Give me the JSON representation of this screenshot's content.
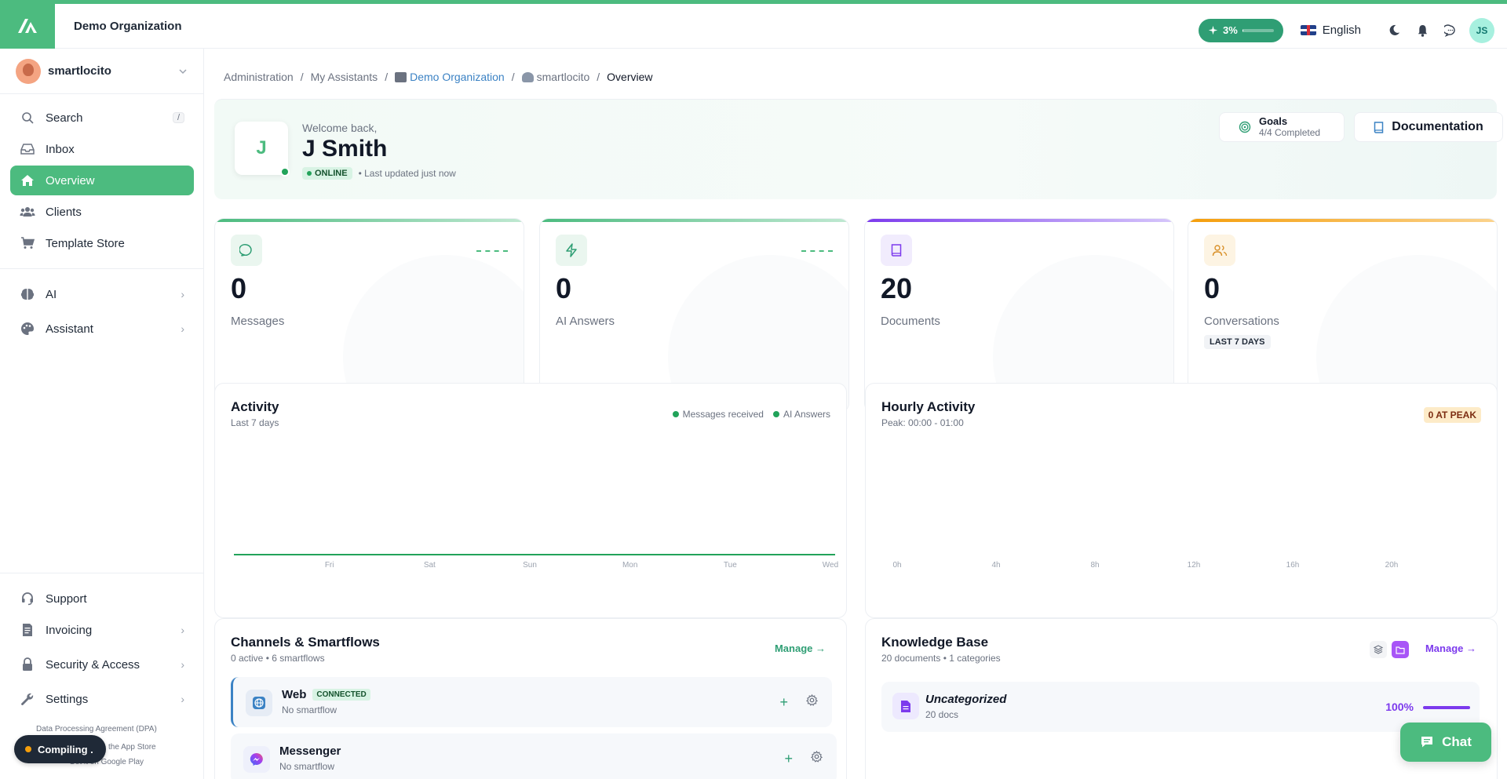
{
  "topbar": {
    "org_name": "Demo Organization",
    "credits_pct_label": "3%",
    "credits_pct": 3,
    "language": "English",
    "user_initials": "JS"
  },
  "sidebar": {
    "user_name": "smartlocito",
    "search_label": "Search",
    "search_shortcut": "/",
    "items": [
      {
        "label": "Inbox",
        "icon": "inbox-icon"
      },
      {
        "label": "Overview",
        "icon": "home-icon",
        "active": true
      },
      {
        "label": "Clients",
        "icon": "users-icon"
      },
      {
        "label": "Template Store",
        "icon": "cart-icon"
      }
    ],
    "groups": [
      {
        "label": "AI",
        "icon": "brain-icon"
      },
      {
        "label": "Assistant",
        "icon": "palette-icon"
      }
    ],
    "bottom_items": [
      {
        "label": "Support",
        "icon": "headset-icon"
      },
      {
        "label": "Invoicing",
        "icon": "invoice-icon"
      },
      {
        "label": "Security & Access",
        "icon": "lock-icon"
      },
      {
        "label": "Settings",
        "icon": "wrench-icon"
      }
    ],
    "footer_links": {
      "dpa": "Data Processing Agreement (DPA)",
      "app_store": "the App Store",
      "google_play": "Get it on Google Play"
    },
    "compiling_label": "Compiling ."
  },
  "breadcrumb": {
    "items": [
      "Administration",
      "My Assistants",
      "Demo Organization",
      "smartlocito",
      "Overview"
    ]
  },
  "welcome": {
    "initial": "J",
    "greeting": "Welcome back,",
    "name": "J Smith",
    "status": "ONLINE",
    "updated": "• Last updated just now",
    "goals_title": "Goals",
    "goals_sub": "4/4 Completed",
    "documentation": "Documentation"
  },
  "stats": [
    {
      "value": "0",
      "label": "Messages",
      "color": "#4cbb7f",
      "icon": "chat-bubble-icon"
    },
    {
      "value": "0",
      "label": "AI Answers",
      "color": "#4cbb7f",
      "icon": "lightning-icon"
    },
    {
      "value": "20",
      "label": "Documents",
      "color": "#7c3aed",
      "icon": "book-icon"
    },
    {
      "value": "0",
      "label": "Conversations",
      "color": "#f59e0b",
      "icon": "users-icon",
      "badge": "LAST 7 DAYS"
    }
  ],
  "activity": {
    "title": "Activity",
    "subtitle": "Last 7 days",
    "legend": [
      "Messages received",
      "AI Answers"
    ]
  },
  "hourly": {
    "title": "Hourly Activity",
    "subtitle": "Peak: 00:00 - 01:00",
    "badge": "0 AT PEAK"
  },
  "chart_data": [
    {
      "type": "line",
      "title": "Activity",
      "x": [
        "Fri",
        "Sat",
        "Sun",
        "Mon",
        "Tue",
        "Wed"
      ],
      "series": [
        {
          "name": "Messages received",
          "values": [
            0,
            0,
            0,
            0,
            0,
            0
          ]
        },
        {
          "name": "AI Answers",
          "values": [
            0,
            0,
            0,
            0,
            0,
            0
          ]
        }
      ],
      "legend": "top-right",
      "grid": false
    },
    {
      "type": "bar",
      "title": "Hourly Activity",
      "categories": [
        "0h",
        "4h",
        "8h",
        "12h",
        "16h",
        "20h"
      ],
      "values": [
        0,
        0,
        0,
        0,
        0,
        0
      ],
      "grid": false
    }
  ],
  "channels": {
    "title": "Channels & Smartflows",
    "subtitle": "0 active • 6 smartflows",
    "manage": "Manage",
    "items": [
      {
        "name": "Web",
        "badge": "CONNECTED",
        "sub": "No smartflow",
        "icon": "globe-icon"
      },
      {
        "name": "Messenger",
        "badge": "",
        "sub": "No smartflow",
        "icon": "messenger-icon"
      }
    ]
  },
  "knowledge": {
    "title": "Knowledge Base",
    "subtitle": "20 documents • 1 categories",
    "manage": "Manage",
    "items": [
      {
        "name": "Uncategorized",
        "sub": "20 docs",
        "pct_label": "100%",
        "pct": 100
      }
    ]
  },
  "chat_button": "Chat"
}
